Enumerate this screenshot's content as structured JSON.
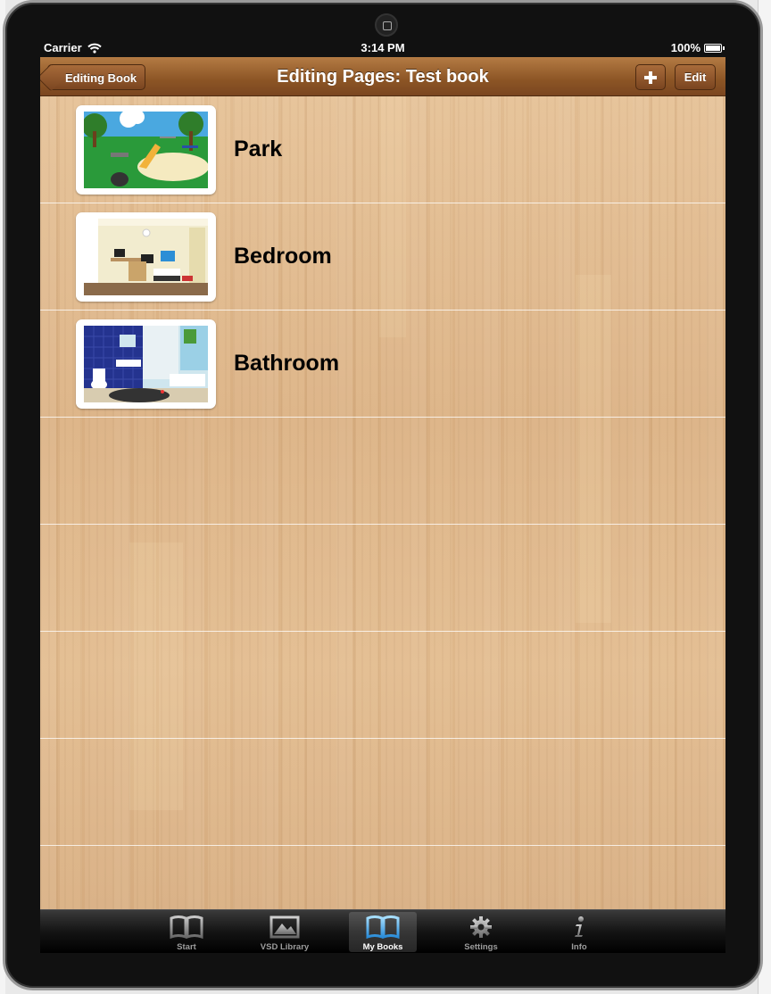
{
  "status_bar": {
    "carrier": "Carrier",
    "time": "3:14 PM",
    "battery": "100%",
    "icons": [
      "wifi-icon",
      "battery-icon"
    ]
  },
  "nav": {
    "back_label": "Editing Book",
    "title": "Editing Pages: Test book",
    "add_icon": "plus-icon",
    "edit_label": "Edit"
  },
  "pages": [
    {
      "label": "Park",
      "thumbnail": "park-thumbnail"
    },
    {
      "label": "Bedroom",
      "thumbnail": "bedroom-thumbnail"
    },
    {
      "label": "Bathroom",
      "thumbnail": "bathroom-thumbnail"
    }
  ],
  "tabs": [
    {
      "label": "Start",
      "icon": "book-icon",
      "selected": false
    },
    {
      "label": "VSD Library",
      "icon": "picture-icon",
      "selected": false
    },
    {
      "label": "My Books",
      "icon": "open-book-icon",
      "selected": true
    },
    {
      "label": "Settings",
      "icon": "gear-icon",
      "selected": false
    },
    {
      "label": "Info",
      "icon": "info-icon",
      "selected": false
    }
  ],
  "colors": {
    "navbar": "#8c5525",
    "wood": "#deb68a",
    "tabbar": "#141414",
    "selected_tab_icon": "#5ab4ea"
  }
}
